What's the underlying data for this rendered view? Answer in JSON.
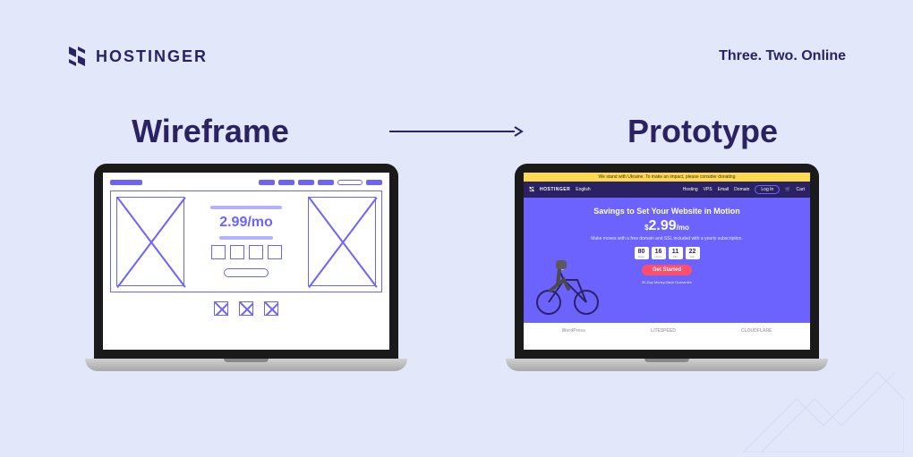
{
  "header": {
    "brand": "HOSTINGER",
    "tagline": "Three. Two. Online"
  },
  "titles": {
    "left": "Wireframe",
    "right": "Prototype"
  },
  "wireframe": {
    "price": "2.99/mo"
  },
  "prototype": {
    "banner": "We stand with Ukraine. To make an impact, please consider donating",
    "nav": {
      "brand": "HOSTINGER",
      "lang": "English",
      "items": [
        "Hosting",
        "VPS",
        "Email",
        "Domain"
      ],
      "login": "Log In",
      "cart": "Cart"
    },
    "hero": {
      "title": "Savings to Set Your Website in Motion",
      "currency": "$",
      "price_big": "2.99",
      "price_unit": "/mo",
      "subtitle": "Make moves with a free domain and SSL included with a yearly subscription.",
      "counters": [
        {
          "num": "80",
          "label": "Days"
        },
        {
          "num": "16",
          "label": "Hours"
        },
        {
          "num": "11",
          "label": "Min"
        },
        {
          "num": "22",
          "label": "Sec"
        }
      ],
      "cta": "Get Started",
      "guarantee": "30-Day Money-Back Guarantee"
    },
    "partners": [
      "WordPress",
      "LITESPEED",
      "CLOUDFLARE"
    ]
  },
  "colors": {
    "accent": "#6c63ff",
    "dark": "#2a2263",
    "bg": "#e3e7fa",
    "cta": "#ff4d6d"
  }
}
